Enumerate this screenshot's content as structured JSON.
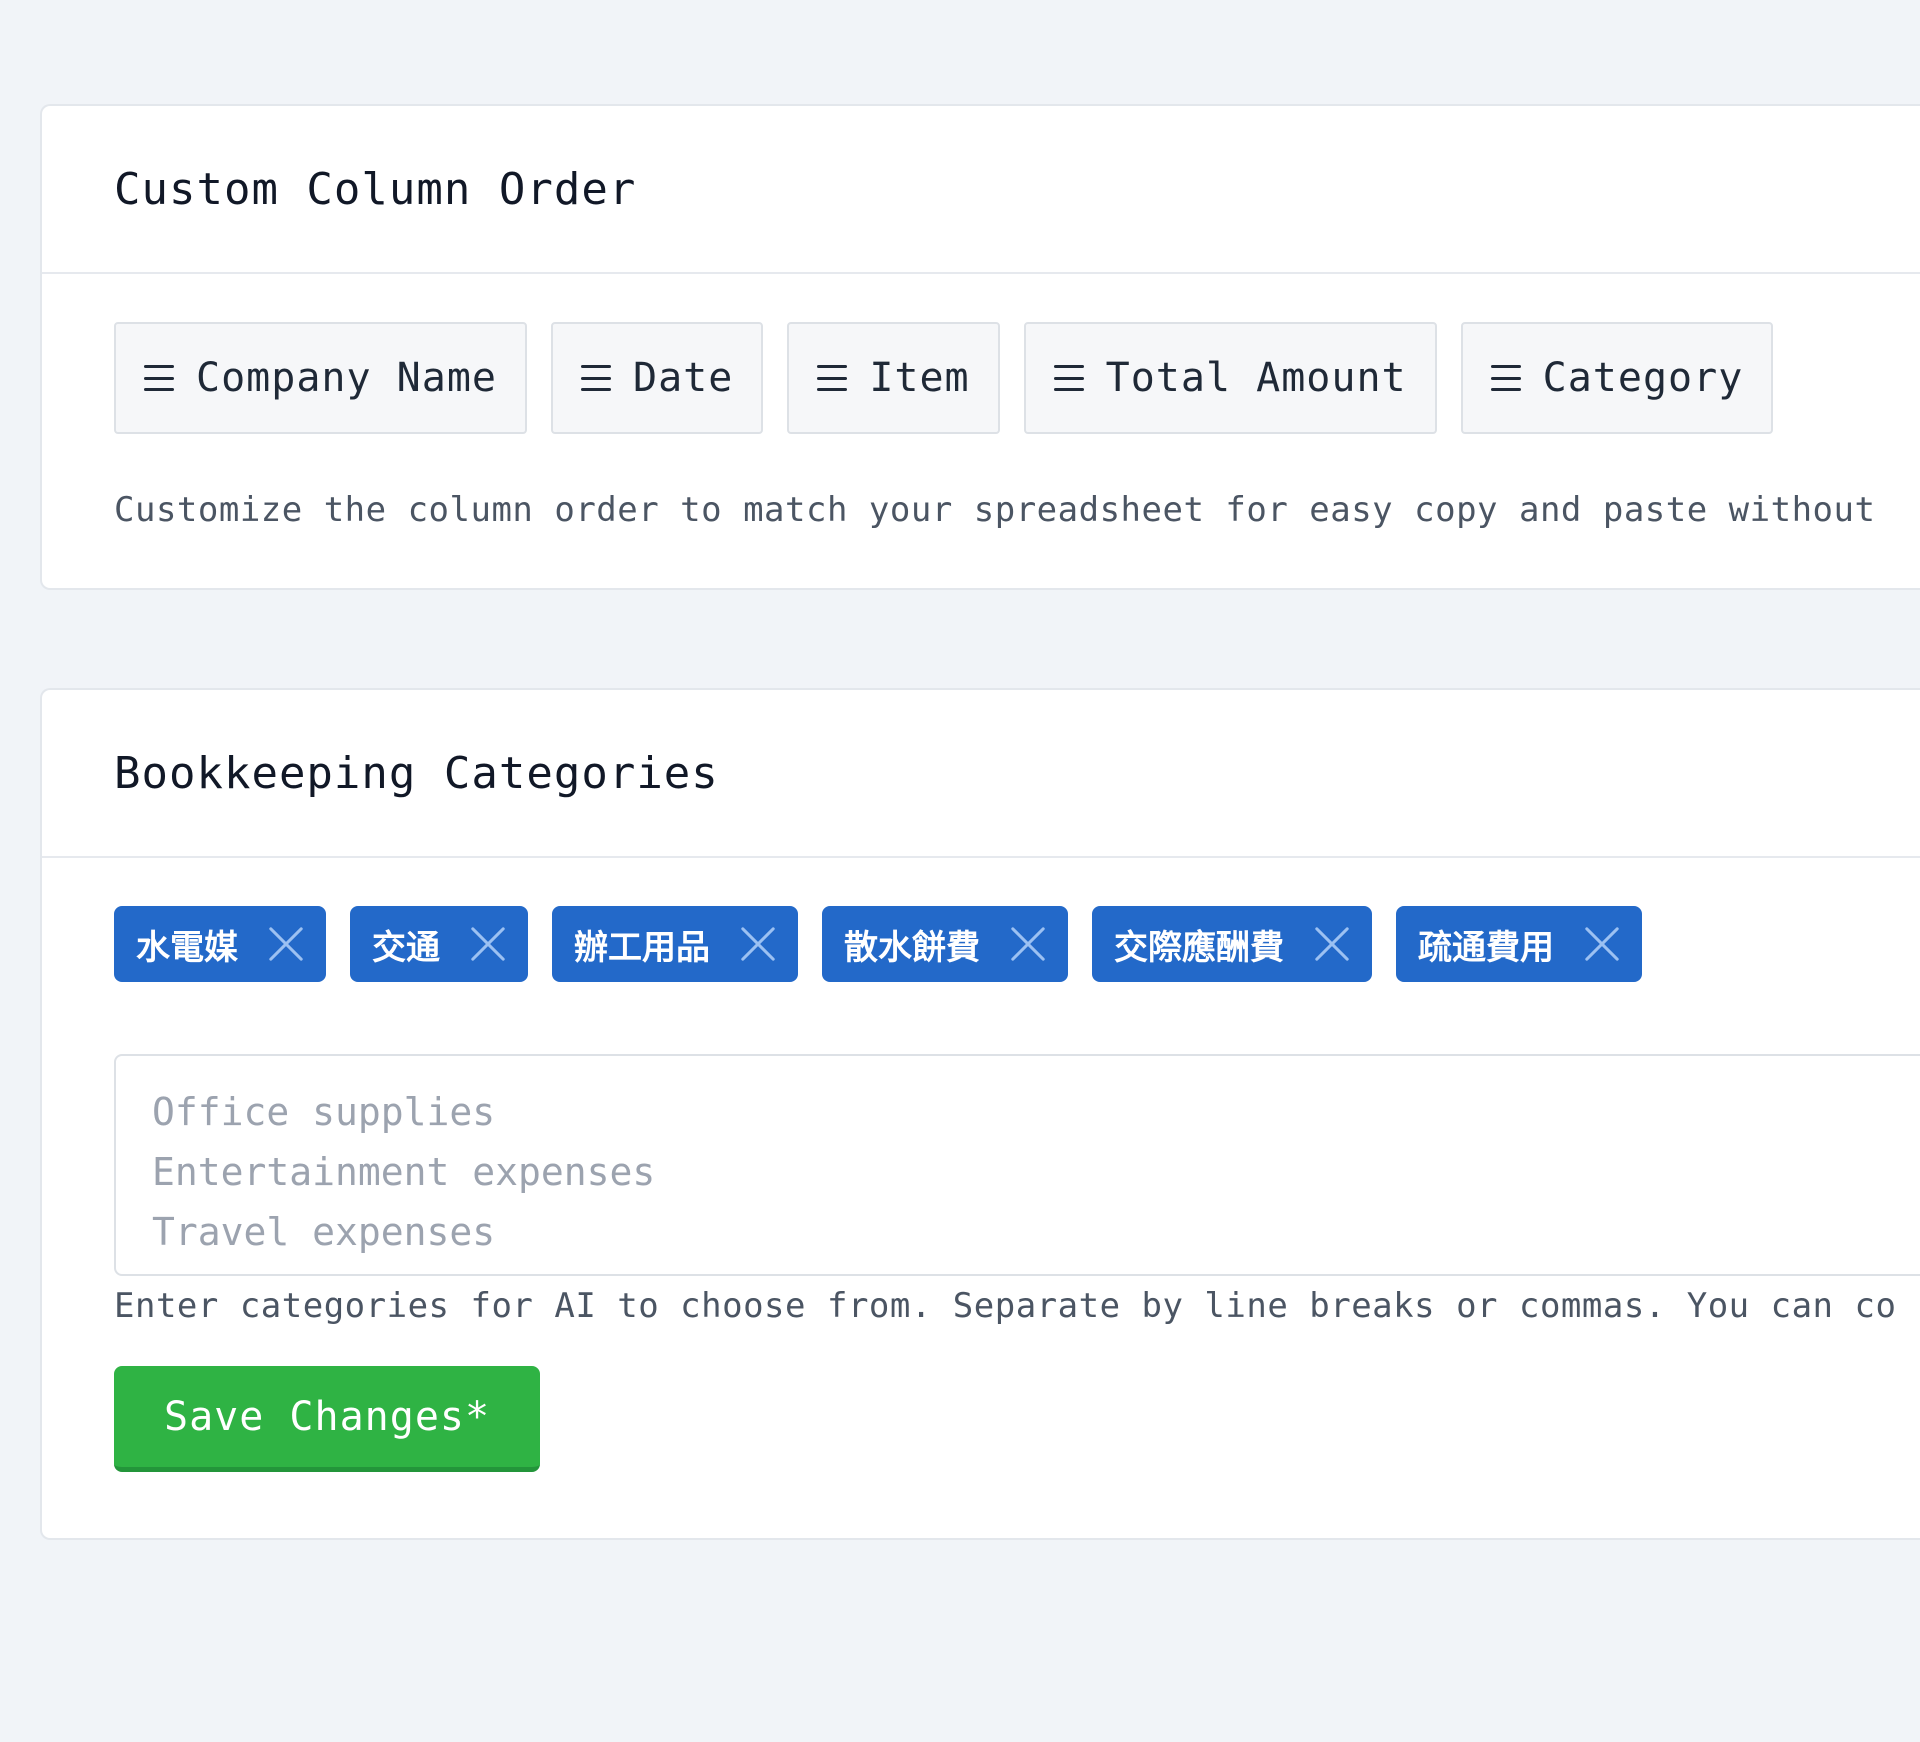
{
  "column_order": {
    "title": "Custom Column Order",
    "columns": [
      {
        "label": "Company Name"
      },
      {
        "label": "Date"
      },
      {
        "label": "Item"
      },
      {
        "label": "Total Amount"
      },
      {
        "label": "Category"
      }
    ],
    "help_text": "Customize the column order to match your spreadsheet for easy copy and paste without"
  },
  "bookkeeping": {
    "title": "Bookkeeping Categories",
    "tags": [
      {
        "label": "水電媒"
      },
      {
        "label": "交通"
      },
      {
        "label": "辦工用品"
      },
      {
        "label": "散水餅費"
      },
      {
        "label": "交際應酬費"
      },
      {
        "label": "疏通費用"
      }
    ],
    "textarea_placeholder": "Office supplies\nEntertainment expenses\nTravel expenses",
    "help_text": "Enter categories for AI to choose from. Separate by line breaks or commas. You can co",
    "save_label": "Save Changes*"
  },
  "colors": {
    "page_background": "#f1f4f8",
    "tag_blue": "#2369c9",
    "save_green": "#2fb344"
  }
}
